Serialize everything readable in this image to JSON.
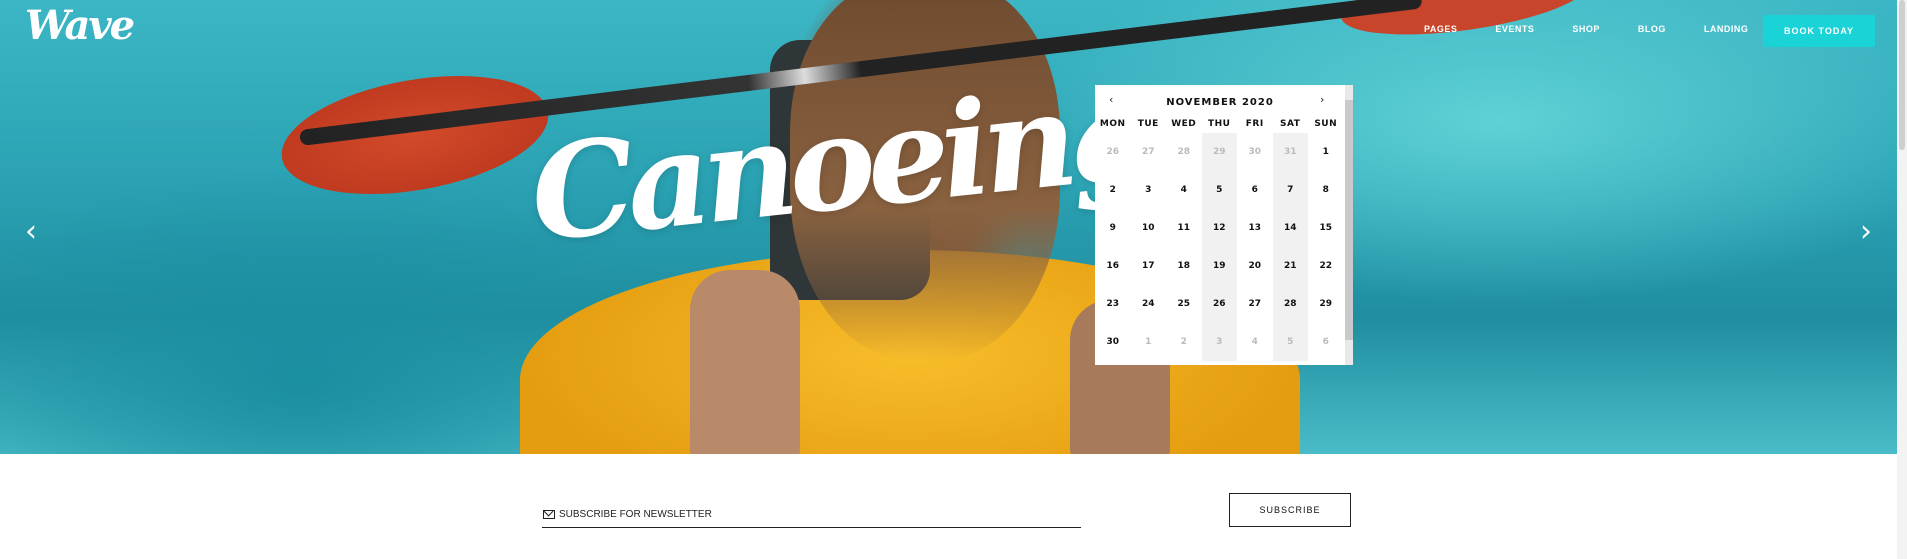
{
  "brand": {
    "logo_text": "Wave"
  },
  "nav": {
    "items": [
      "PAGES",
      "EVENTS",
      "SHOP",
      "BLOG",
      "LANDING"
    ],
    "cta_label": "BOOK TODAY"
  },
  "hero": {
    "title": "Canoeing",
    "prev_icon": "chevron-left-icon",
    "next_icon": "chevron-right-icon"
  },
  "calendar": {
    "month_label": "NOVEMBER 2020",
    "prev_glyph": "‹",
    "next_glyph": "›",
    "weekdays": [
      "MON",
      "TUE",
      "WED",
      "THU",
      "FRI",
      "SAT",
      "SUN"
    ],
    "days": [
      {
        "d": "26",
        "muted": true
      },
      {
        "d": "27",
        "muted": true
      },
      {
        "d": "28",
        "muted": true
      },
      {
        "d": "29",
        "muted": true
      },
      {
        "d": "30",
        "muted": true
      },
      {
        "d": "31",
        "muted": true
      },
      {
        "d": "1",
        "muted": false
      },
      {
        "d": "2",
        "muted": false
      },
      {
        "d": "3",
        "muted": false
      },
      {
        "d": "4",
        "muted": false
      },
      {
        "d": "5",
        "muted": false
      },
      {
        "d": "6",
        "muted": false
      },
      {
        "d": "7",
        "muted": false
      },
      {
        "d": "8",
        "muted": false
      },
      {
        "d": "9",
        "muted": false
      },
      {
        "d": "10",
        "muted": false
      },
      {
        "d": "11",
        "muted": false
      },
      {
        "d": "12",
        "muted": false
      },
      {
        "d": "13",
        "muted": false
      },
      {
        "d": "14",
        "muted": false
      },
      {
        "d": "15",
        "muted": false
      },
      {
        "d": "16",
        "muted": false
      },
      {
        "d": "17",
        "muted": false
      },
      {
        "d": "18",
        "muted": false
      },
      {
        "d": "19",
        "muted": false
      },
      {
        "d": "20",
        "muted": false
      },
      {
        "d": "21",
        "muted": false
      },
      {
        "d": "22",
        "muted": false
      },
      {
        "d": "23",
        "muted": false
      },
      {
        "d": "24",
        "muted": false
      },
      {
        "d": "25",
        "muted": false
      },
      {
        "d": "26",
        "muted": false
      },
      {
        "d": "27",
        "muted": false
      },
      {
        "d": "28",
        "muted": false
      },
      {
        "d": "29",
        "muted": false
      },
      {
        "d": "30",
        "muted": false
      },
      {
        "d": "1",
        "muted": true
      },
      {
        "d": "2",
        "muted": true
      },
      {
        "d": "3",
        "muted": true
      },
      {
        "d": "4",
        "muted": true
      },
      {
        "d": "5",
        "muted": true
      },
      {
        "d": "6",
        "muted": true
      }
    ]
  },
  "newsletter": {
    "label": "SUBSCRIBE FOR NEWSLETTER",
    "button_label": "SUBSCRIBE"
  },
  "colors": {
    "accent": "#19d3d6"
  }
}
